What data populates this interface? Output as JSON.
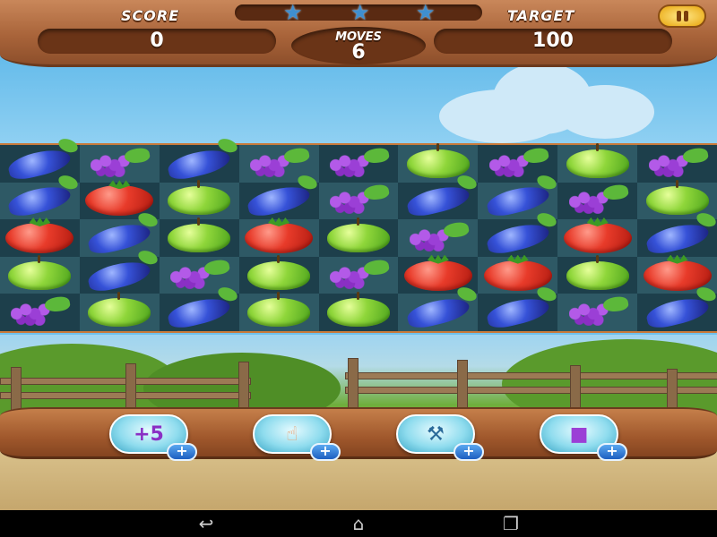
{
  "hud": {
    "score_label": "SCORE",
    "score_value": "0",
    "target_label": "TARGET",
    "target_value": "100",
    "moves_label": "MOVES",
    "moves_value": "6",
    "stars_total": 3,
    "pause_icon": "pause-icon"
  },
  "board": {
    "columns": 9,
    "rows": 5,
    "grid": [
      [
        "eggplant",
        "grapes",
        "eggplant",
        "grapes",
        "grapes",
        "apple",
        "grapes",
        "apple",
        "grapes"
      ],
      [
        "eggplant",
        "tomato",
        "apple",
        "eggplant",
        "grapes",
        "eggplant",
        "eggplant",
        "grapes",
        "apple"
      ],
      [
        "tomato",
        "eggplant",
        "apple",
        "tomato",
        "apple",
        "grapes",
        "eggplant",
        "tomato",
        "eggplant"
      ],
      [
        "apple",
        "eggplant",
        "grapes",
        "apple",
        "grapes",
        "tomato",
        "tomato",
        "apple",
        "tomato"
      ],
      [
        "grapes",
        "apple",
        "eggplant",
        "apple",
        "apple",
        "eggplant",
        "eggplant",
        "grapes",
        "eggplant"
      ]
    ]
  },
  "boosters": [
    {
      "name": "extra-moves-booster",
      "icon": "plus-five-moves-icon",
      "label": "+5",
      "badge": "+"
    },
    {
      "name": "hand-swap-booster",
      "icon": "hand-pointer-icon",
      "label": "",
      "badge": "+"
    },
    {
      "name": "shovel-booster",
      "icon": "shovel-icon",
      "label": "",
      "badge": "+"
    },
    {
      "name": "bomb-booster",
      "icon": "candy-bomb-icon",
      "label": "",
      "badge": "+"
    }
  ],
  "navbar": {
    "back_icon": "back-icon",
    "home_icon": "home-icon",
    "recents_icon": "recents-icon"
  }
}
